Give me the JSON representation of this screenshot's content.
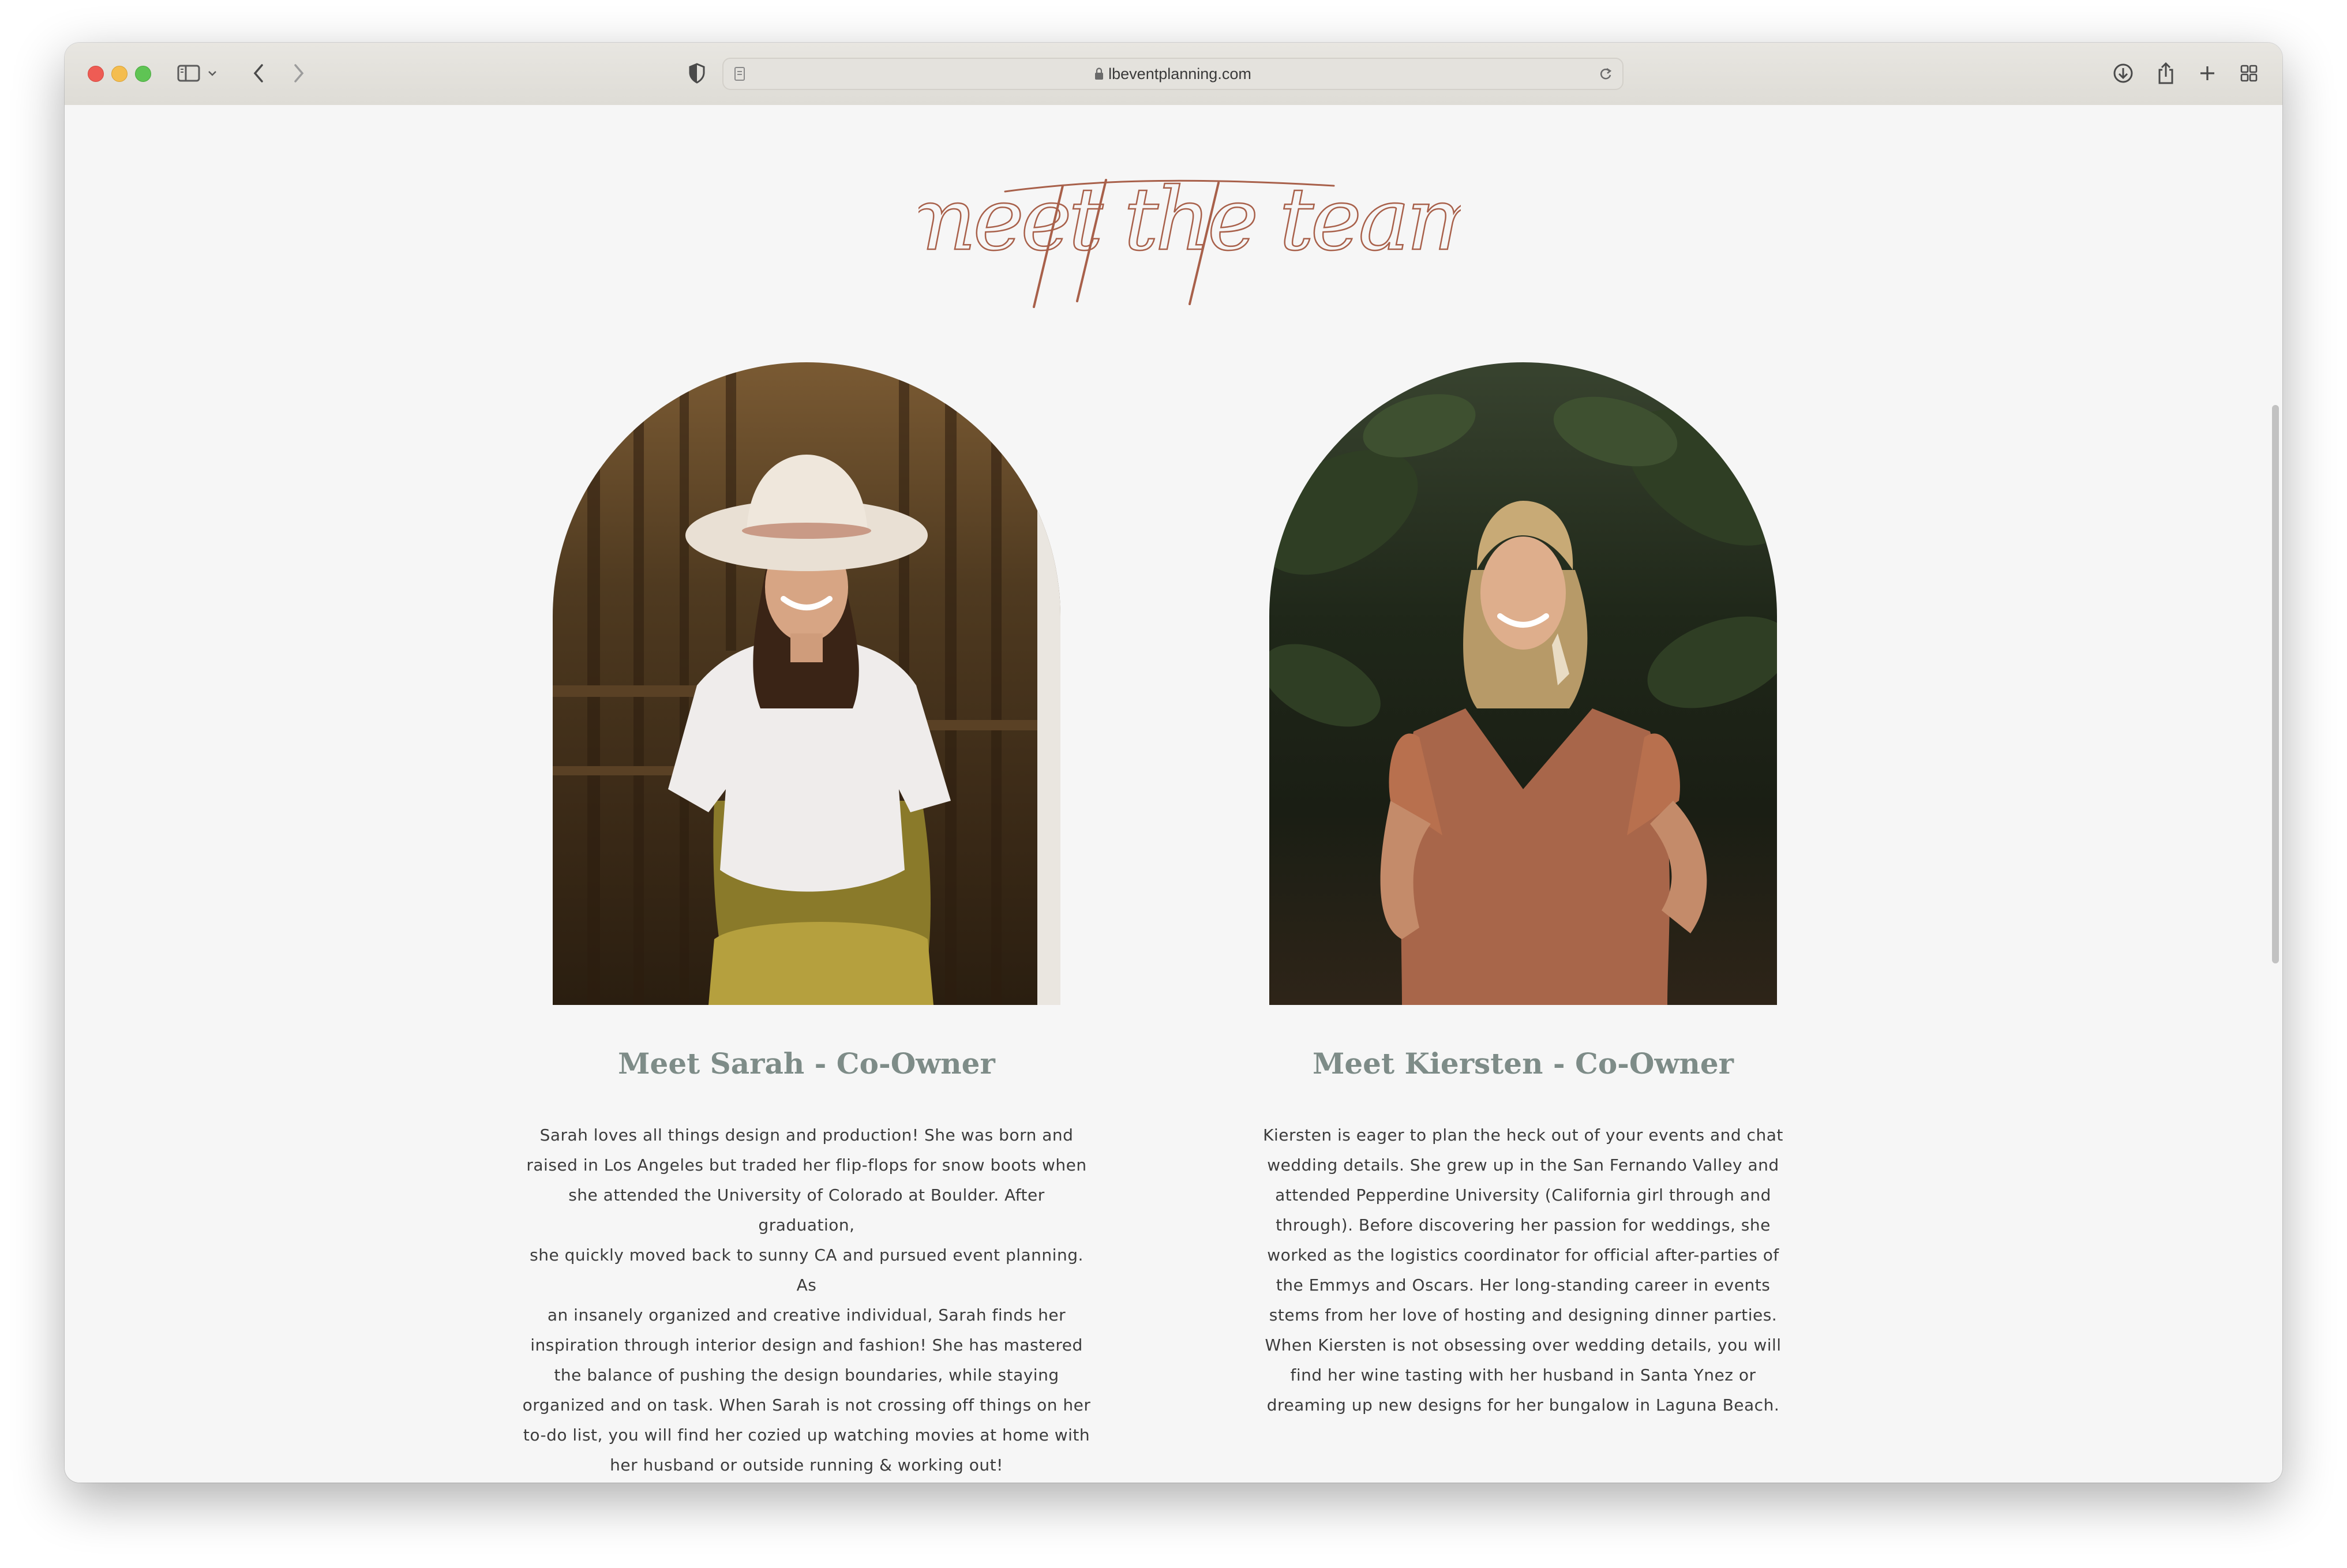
{
  "browser": {
    "url": "lbeventplanning.com"
  },
  "page": {
    "heading": "meet the team"
  },
  "team": [
    {
      "title": "Meet Sarah  - Co-Owner",
      "photo_alt": "Sarah",
      "bio_lines": [
        "Sarah loves all things design and production! She was born and",
        "raised in Los Angeles but traded her flip-flops for snow boots when",
        "she attended the University of Colorado at Boulder. After graduation,",
        "she quickly moved back to sunny CA and pursued event planning. As",
        "an insanely organized and creative individual, Sarah finds her",
        "inspiration through interior design and fashion! She has mastered",
        "the balance of pushing the design boundaries, while staying",
        "organized and on task. When Sarah is not crossing off things on her",
        "to-do list, you will find her cozied up watching movies at home with",
        "her husband or outside running & working out!"
      ]
    },
    {
      "title": "Meet Kiersten - Co-Owner",
      "photo_alt": "Kiersten",
      "bio_lines": [
        "Kiersten is eager to plan the heck out of your events and chat",
        "wedding details. She grew up in the San Fernando Valley and",
        "attended Pepperdine University (California girl through and",
        "through). Before discovering her passion for weddings, she",
        "worked as the logistics coordinator for official after-parties of",
        "the Emmys and Oscars. Her long-standing career in events",
        "stems from her love of hosting and designing dinner parties.",
        "When Kiersten is not obsessing over wedding details, you will",
        "find her wine tasting with her husband in Santa Ynez or",
        "dreaming up new designs for her bungalow in Laguna Beach."
      ]
    }
  ],
  "colors": {
    "accent_script": "#a8604a",
    "title_color": "#7e8c88",
    "page_bg": "#f6f6f6"
  }
}
